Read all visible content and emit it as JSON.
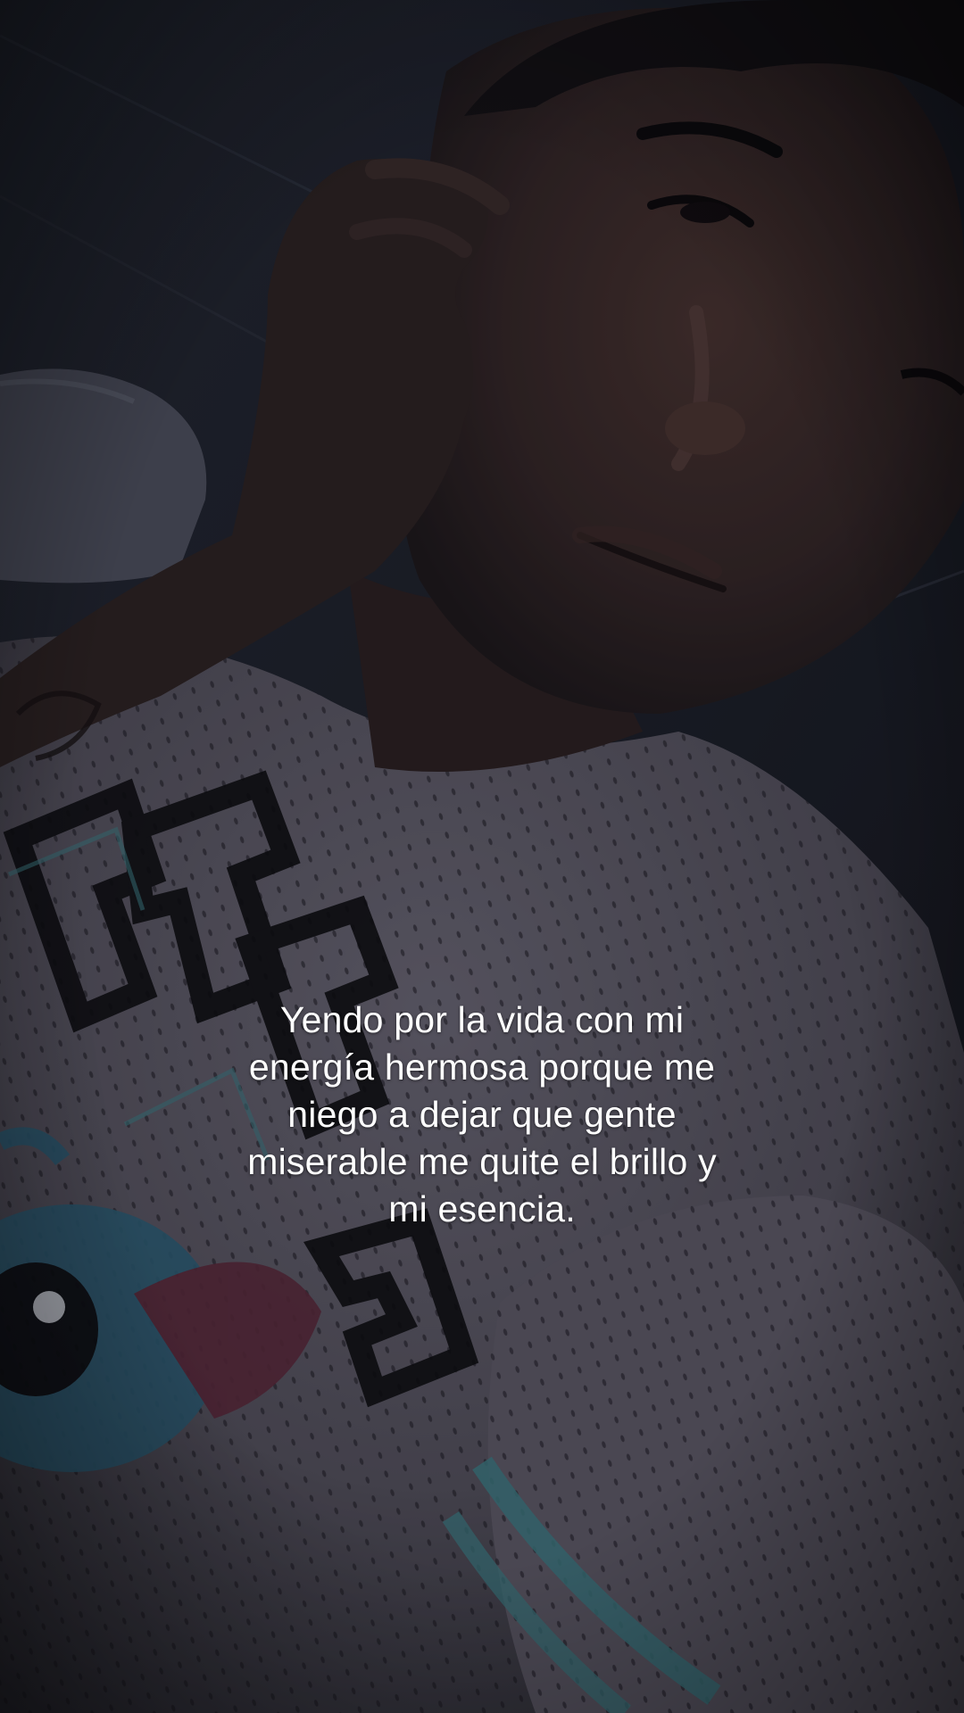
{
  "overlay": {
    "caption": "Yendo por la vida con mi\nenergía hermosa porque me\nniego a dejar que gente\nmiserable me quite el brillo y\nmi esencia."
  },
  "colors": {
    "background": "#1e202b",
    "shirt": "#5e5b68",
    "skin": "#3a2a28",
    "jersey_letters": "#0f0f14",
    "teal_accent": "#3f7c86",
    "caption_text": "#ffffff"
  }
}
